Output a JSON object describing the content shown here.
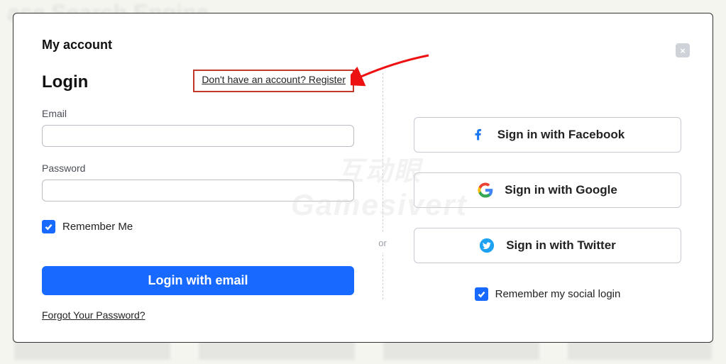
{
  "header": {
    "title": "My account",
    "login_heading": "Login",
    "register_link": "Don't have an account? Register"
  },
  "fields": {
    "email_label": "Email",
    "password_label": "Password"
  },
  "remember": {
    "me_label": "Remember Me",
    "social_label": "Remember my social login"
  },
  "buttons": {
    "login_email": "Login with email"
  },
  "links": {
    "forgot": "Forgot Your Password?"
  },
  "divider": {
    "or": "or"
  },
  "social": {
    "facebook": "Sign in with Facebook",
    "google": "Sign in with Google",
    "twitter": "Sign in with Twitter"
  },
  "watermark": {
    "line1": "互动眼",
    "line2": "Gamesivert"
  },
  "close_glyph": "×"
}
